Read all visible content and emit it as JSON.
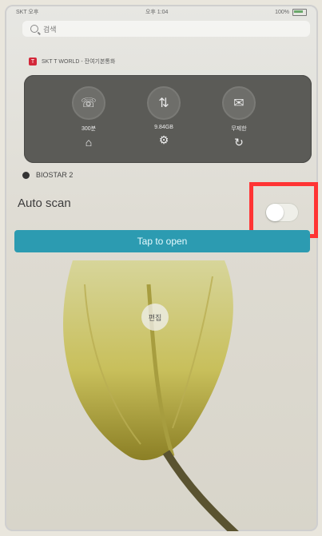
{
  "status_bar": {
    "left_text": "SKT 오후",
    "time": "오후 1:04",
    "right_text": "100%"
  },
  "search": {
    "text": "검색"
  },
  "tworld": {
    "title": "SKT T WORLD - 잔여기본통화",
    "items": [
      {
        "value": "300분",
        "icon": "home-icon",
        "circle_icon": "phone-icon"
      },
      {
        "value": "9.84GB",
        "icon": "gear-icon",
        "circle_icon": "data-icon"
      },
      {
        "value": "무제한",
        "icon": "refresh-icon",
        "circle_icon": "message-icon"
      }
    ]
  },
  "biostar": {
    "title": "BIOSTAR 2"
  },
  "auto_scan": {
    "label": "Auto scan",
    "toggle_state": "off"
  },
  "tap_button": {
    "label": "Tap to open"
  },
  "edit_badge": {
    "label": "편집"
  },
  "colors": {
    "accent": "#2c9bb1",
    "highlight": "#ff3434",
    "tworld": "#5b5b57"
  }
}
